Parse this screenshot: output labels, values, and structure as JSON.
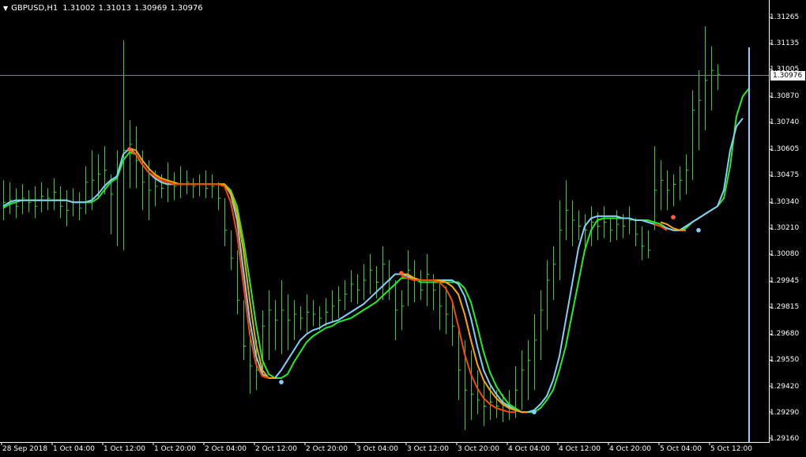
{
  "symbol_bar": {
    "arrow": "▼",
    "symbol": "GBPUSD,H1",
    "open": "1.31002",
    "high": "1.31013",
    "low": "1.30969",
    "close": "1.30976"
  },
  "colors": {
    "background": "#000000",
    "axis": "#ffffff",
    "bars": "#32cd32",
    "bid_line": "#708090",
    "line_green": "#22ee22",
    "line_blue": "#87cefa",
    "line_orange": "#ffa500",
    "line_red": "#ff4500",
    "dot_blue": "#87cefa",
    "dot_orange": "#ff6633"
  },
  "price_axis": {
    "labels": [
      "1.31265",
      "1.31135",
      "1.31005",
      "1.30870",
      "1.30740",
      "1.30605",
      "1.30475",
      "1.30340",
      "1.30210",
      "1.30080",
      "1.29945",
      "1.29815",
      "1.29680",
      "1.29550",
      "1.29420",
      "1.29290",
      "1.29160"
    ],
    "current_price": "1.30976"
  },
  "time_axis": {
    "labels": [
      "28 Sep 2018",
      "1 Oct 04:00",
      "1 Oct 12:00",
      "1 Oct 20:00",
      "2 Oct 04:00",
      "2 Oct 12:00",
      "2 Oct 20:00",
      "3 Oct 04:00",
      "3 Oct 12:00",
      "3 Oct 20:00",
      "4 Oct 04:00",
      "4 Oct 12:00",
      "4 Oct 20:00",
      "5 Oct 04:00",
      "5 Oct 12:00"
    ]
  },
  "chart_data": {
    "type": "line",
    "title": "",
    "x_axis": "time (H1 bars)",
    "y_range": [
      1.2913,
      1.313
    ],
    "vertical_marker_bar": 118,
    "series": [
      {
        "name": "",
        "color": "#22ee22",
        "values": [
          1.3031,
          1.3033,
          1.3034,
          1.3035,
          1.3035,
          1.3035,
          1.3035,
          1.3035,
          1.3035,
          1.3035,
          1.3035,
          1.3034,
          1.3034,
          1.3034,
          1.3034,
          1.3036,
          1.304,
          1.3044,
          1.3046,
          1.3055,
          1.3059,
          1.3058,
          1.3053,
          1.3049,
          1.3046,
          1.3044,
          1.3043,
          1.3043,
          1.3043,
          1.3043,
          1.3043,
          1.3043,
          1.3043,
          1.3043,
          1.3043,
          1.3043,
          1.304,
          1.3032,
          1.3015,
          1.2995,
          1.2973,
          1.2955,
          1.2948,
          1.2946,
          1.2946,
          1.2948,
          1.2954,
          1.2959,
          1.2964,
          1.2967,
          1.2969,
          1.2971,
          1.2972,
          1.2974,
          1.2975,
          1.2976,
          1.2978,
          1.298,
          1.2982,
          1.2984,
          1.2987,
          1.299,
          1.2993,
          1.2996,
          1.2996,
          1.2996,
          1.2994,
          1.2994,
          1.2994,
          1.2994,
          1.2994,
          1.2994,
          1.2994,
          1.2991,
          1.2984,
          1.2972,
          1.2959,
          1.2949,
          1.2942,
          1.2937,
          1.2933,
          1.2931,
          1.2929,
          1.2929,
          1.2929,
          1.2931,
          1.2935,
          1.294,
          1.295,
          1.2962,
          1.2978,
          1.2994,
          1.301,
          1.302,
          1.3025,
          1.3026,
          1.3026,
          1.3026,
          1.3026,
          1.3026,
          1.3025,
          1.3025,
          1.3025,
          1.3024,
          1.3023,
          1.3021,
          1.302,
          1.302,
          1.3021,
          1.3024,
          1.3026,
          1.3028,
          1.303,
          1.3032,
          1.3036,
          1.3052,
          1.3077,
          1.3087,
          1.3091
        ]
      },
      {
        "name": "",
        "color": "#87cefa",
        "values": [
          1.3032,
          1.3034,
          1.3035,
          1.3035,
          1.3035,
          1.3035,
          1.3035,
          1.3035,
          1.3035,
          1.3035,
          1.3035,
          1.3034,
          1.3034,
          1.3034,
          1.3035,
          1.3038,
          1.3042,
          1.3045,
          1.3047,
          1.3058,
          1.3061,
          1.3058,
          1.3053,
          1.3049,
          1.3046,
          1.3044,
          1.3043,
          1.3043,
          1.3043,
          1.3043,
          1.3043,
          1.3043,
          1.3043,
          1.3043,
          1.3043,
          1.3043,
          1.3038,
          1.3025,
          1.3,
          1.2975,
          1.2957,
          1.2948,
          1.2946,
          1.2946,
          1.295,
          1.2955,
          1.296,
          1.2965,
          1.2968,
          1.297,
          1.2971,
          1.2973,
          1.2974,
          1.2975,
          1.2977,
          1.2979,
          1.2981,
          1.2983,
          1.2986,
          1.2989,
          1.2992,
          1.2995,
          1.2998,
          1.2998,
          1.2997,
          1.2996,
          1.2995,
          1.2995,
          1.2995,
          1.2995,
          1.2995,
          1.2995,
          1.2993,
          1.2987,
          1.2976,
          1.2962,
          1.295,
          1.2943,
          1.2938,
          1.2934,
          1.2932,
          1.293,
          1.2929,
          1.2929,
          1.293,
          1.2933,
          1.2937,
          1.2945,
          1.2957,
          1.2975,
          1.2993,
          1.3011,
          1.3022,
          1.3026,
          1.3027,
          1.3027,
          1.3027,
          1.3027,
          1.3026,
          1.3026,
          1.3025,
          1.3025,
          1.3024,
          1.3023,
          1.3022,
          1.3021,
          1.302,
          1.302,
          1.3022,
          1.3024,
          1.3026,
          1.3028,
          1.303,
          1.3032,
          1.304,
          1.306,
          1.3072,
          1.3076
        ]
      },
      {
        "name": "",
        "color": "#ffa500",
        "values": [
          null,
          null,
          null,
          null,
          null,
          null,
          null,
          null,
          null,
          null,
          null,
          null,
          null,
          null,
          null,
          null,
          null,
          null,
          null,
          null,
          1.3061,
          1.306,
          1.3055,
          1.3051,
          1.3048,
          1.3046,
          1.3045,
          1.3044,
          1.3043,
          1.3043,
          1.3043,
          1.3043,
          1.3043,
          1.3043,
          1.3043,
          1.3043,
          1.3039,
          1.3029,
          1.301,
          1.2985,
          1.2963,
          1.295,
          1.2946,
          1.2946,
          null,
          null,
          null,
          null,
          null,
          null,
          null,
          null,
          null,
          null,
          null,
          null,
          null,
          null,
          null,
          null,
          null,
          null,
          null,
          1.2998,
          1.2998,
          1.2996,
          1.2995,
          1.2995,
          1.2995,
          1.2995,
          1.2994,
          1.2992,
          1.2988,
          1.2978,
          1.2965,
          1.2953,
          1.2945,
          1.294,
          1.2936,
          1.2933,
          1.2931,
          1.293,
          1.2929,
          1.2929,
          null,
          null,
          null,
          null,
          null,
          null,
          null,
          null,
          null,
          null,
          null,
          null,
          null,
          null,
          null,
          null,
          null,
          null,
          null,
          null,
          1.3024,
          1.3023,
          1.3021,
          1.302,
          1.302,
          null,
          null,
          null,
          null,
          null,
          null,
          null,
          null,
          null,
          null
        ]
      },
      {
        "name": "",
        "color": "#ff4500",
        "values": [
          null,
          null,
          null,
          null,
          null,
          null,
          null,
          null,
          null,
          null,
          null,
          null,
          null,
          null,
          null,
          null,
          null,
          null,
          null,
          null,
          1.306,
          1.3058,
          1.3053,
          1.3049,
          1.3047,
          1.3045,
          1.3044,
          1.3043,
          1.3043,
          1.3043,
          1.3043,
          1.3043,
          1.3043,
          1.3043,
          1.3043,
          1.3042,
          1.3034,
          1.3018,
          1.2993,
          1.2968,
          1.2953,
          1.2947,
          1.2946,
          null,
          null,
          null,
          null,
          null,
          null,
          null,
          null,
          null,
          null,
          null,
          null,
          null,
          null,
          null,
          null,
          null,
          null,
          null,
          null,
          1.2997,
          1.2996,
          1.2995,
          1.2995,
          1.2995,
          1.2995,
          1.2994,
          1.2991,
          1.2985,
          1.2972,
          1.2958,
          1.2948,
          1.2941,
          1.2936,
          1.2933,
          1.2931,
          1.293,
          1.2929,
          1.2929,
          null,
          null,
          null,
          null,
          null,
          null,
          null,
          null,
          null,
          null,
          null,
          null,
          null,
          null,
          null,
          null,
          null,
          null,
          null,
          null,
          null,
          1.3023,
          1.3022,
          1.302,
          null,
          null,
          null,
          null,
          null,
          null,
          null,
          null,
          null,
          null,
          null
        ]
      }
    ],
    "markers": [
      {
        "bar": 20,
        "value": 1.30605,
        "color": "#ff6633"
      },
      {
        "bar": 44,
        "value": 1.2944,
        "color": "#87cefa"
      },
      {
        "bar": 63,
        "value": 1.29985,
        "color": "#ff6633"
      },
      {
        "bar": 84,
        "value": 1.2929,
        "color": "#87cefa"
      },
      {
        "bar": 106,
        "value": 1.30265,
        "color": "#ff6633"
      },
      {
        "bar": 110,
        "value": 1.302,
        "color": "#87cefa"
      }
    ],
    "bars_hlc": [
      [
        1.3045,
        1.3025,
        1.3034
      ],
      [
        1.3044,
        1.3028,
        1.3035
      ],
      [
        1.3041,
        1.3026,
        1.3032
      ],
      [
        1.3043,
        1.3028,
        1.3036
      ],
      [
        1.304,
        1.3029,
        1.3034
      ],
      [
        1.3042,
        1.3026,
        1.3032
      ],
      [
        1.3044,
        1.3029,
        1.3037
      ],
      [
        1.3041,
        1.303,
        1.3036
      ],
      [
        1.3046,
        1.303,
        1.3039
      ],
      [
        1.3042,
        1.3026,
        1.3032
      ],
      [
        1.304,
        1.3022,
        1.303
      ],
      [
        1.3041,
        1.3027,
        1.3034
      ],
      [
        1.3039,
        1.3025,
        1.3031
      ],
      [
        1.3052,
        1.3028,
        1.3044
      ],
      [
        1.306,
        1.303,
        1.3045
      ],
      [
        1.3058,
        1.3036,
        1.3048
      ],
      [
        1.3062,
        1.3038,
        1.305
      ],
      [
        1.3048,
        1.3018,
        1.3038
      ],
      [
        1.306,
        1.3012,
        1.305
      ],
      [
        1.3115,
        1.301,
        1.306
      ],
      [
        1.3075,
        1.3041,
        1.3063
      ],
      [
        1.3072,
        1.3041,
        1.3055
      ],
      [
        1.306,
        1.303,
        1.3044
      ],
      [
        1.3055,
        1.3025,
        1.304
      ],
      [
        1.305,
        1.3032,
        1.3042
      ],
      [
        1.3048,
        1.3036,
        1.3041
      ],
      [
        1.3054,
        1.3034,
        1.3043
      ],
      [
        1.3049,
        1.3035,
        1.3042
      ],
      [
        1.3052,
        1.3036,
        1.3043
      ],
      [
        1.305,
        1.3038,
        1.3044
      ],
      [
        1.3046,
        1.3036,
        1.3042
      ],
      [
        1.3048,
        1.3037,
        1.3043
      ],
      [
        1.305,
        1.3036,
        1.3041
      ],
      [
        1.3048,
        1.3036,
        1.3042
      ],
      [
        1.3044,
        1.303,
        1.3036
      ],
      [
        1.3036,
        1.3012,
        1.302
      ],
      [
        1.302,
        1.3,
        1.3006
      ],
      [
        1.301,
        1.2978,
        1.2985
      ],
      [
        1.2985,
        1.2955,
        1.2962
      ],
      [
        1.297,
        1.2938,
        1.2952
      ],
      [
        1.2965,
        1.294,
        1.295
      ],
      [
        1.298,
        1.2948,
        1.2972
      ],
      [
        1.299,
        1.2955,
        1.298
      ],
      [
        1.2985,
        1.296,
        1.2975
      ],
      [
        1.2995,
        1.2958,
        1.298
      ],
      [
        1.2988,
        1.296,
        1.2975
      ],
      [
        1.2985,
        1.2965,
        1.2978
      ],
      [
        1.2982,
        1.297,
        1.2976
      ],
      [
        1.2988,
        1.2968,
        1.2979
      ],
      [
        1.2985,
        1.2972,
        1.2978
      ],
      [
        1.2982,
        1.297,
        1.2976
      ],
      [
        1.2986,
        1.2972,
        1.2979
      ],
      [
        1.299,
        1.2974,
        1.2982
      ],
      [
        1.2992,
        1.2976,
        1.2985
      ],
      [
        1.2995,
        1.298,
        1.2988
      ],
      [
        1.3,
        1.2984,
        1.2993
      ],
      [
        1.2998,
        1.2983,
        1.299
      ],
      [
        1.3003,
        1.2985,
        1.2995
      ],
      [
        1.3008,
        1.2988,
        1.3
      ],
      [
        1.3002,
        1.2986,
        1.2994
      ],
      [
        1.3012,
        1.2985,
        1.3003
      ],
      [
        1.3005,
        1.2985,
        1.2995
      ],
      [
        1.2995,
        1.2965,
        1.298
      ],
      [
        1.299,
        1.297,
        1.2982
      ],
      [
        1.301,
        1.2982,
        1.3
      ],
      [
        1.3005,
        1.2984,
        1.2996
      ],
      [
        1.3,
        1.2985,
        1.299
      ],
      [
        1.3008,
        1.2982,
        1.2998
      ],
      [
        1.2998,
        1.298,
        1.299
      ],
      [
        1.2995,
        1.297,
        1.2982
      ],
      [
        1.2992,
        1.2968,
        1.2978
      ],
      [
        1.2985,
        1.2962,
        1.2972
      ],
      [
        1.297,
        1.2935,
        1.295
      ],
      [
        1.2965,
        1.292,
        1.294
      ],
      [
        1.296,
        1.2925,
        1.2938
      ],
      [
        1.295,
        1.2928,
        1.2935
      ],
      [
        1.2945,
        1.2922,
        1.2932
      ],
      [
        1.2942,
        1.2925,
        1.2934
      ],
      [
        1.294,
        1.2926,
        1.2932
      ],
      [
        1.2938,
        1.2924,
        1.293
      ],
      [
        1.294,
        1.2925,
        1.2931
      ],
      [
        1.2952,
        1.2926,
        1.294
      ],
      [
        1.296,
        1.293,
        1.295
      ],
      [
        1.2965,
        1.2935,
        1.2955
      ],
      [
        1.2978,
        1.294,
        1.2965
      ],
      [
        1.299,
        1.2955,
        1.298
      ],
      [
        1.3005,
        1.297,
        1.2995
      ],
      [
        1.3012,
        1.2985,
        1.3003
      ],
      [
        1.3035,
        1.2995,
        1.302
      ],
      [
        1.3045,
        1.3015,
        1.303
      ],
      [
        1.3035,
        1.3012,
        1.3025
      ],
      [
        1.303,
        1.3015,
        1.3022
      ],
      [
        1.3028,
        1.301,
        1.302
      ],
      [
        1.3032,
        1.3012,
        1.3024
      ],
      [
        1.3029,
        1.3015,
        1.3022
      ],
      [
        1.3032,
        1.3016,
        1.3024
      ],
      [
        1.3026,
        1.3014,
        1.302
      ],
      [
        1.303,
        1.3015,
        1.3023
      ],
      [
        1.3028,
        1.3016,
        1.3022
      ],
      [
        1.3032,
        1.3018,
        1.3025
      ],
      [
        1.3026,
        1.3012,
        1.3018
      ],
      [
        1.3022,
        1.3005,
        1.3012
      ],
      [
        1.302,
        1.3006,
        1.301
      ],
      [
        1.3062,
        1.302,
        1.304
      ],
      [
        1.3055,
        1.303,
        1.3045
      ],
      [
        1.305,
        1.303,
        1.304
      ],
      [
        1.3048,
        1.3032,
        1.3043
      ],
      [
        1.3052,
        1.3035,
        1.3045
      ],
      [
        1.3058,
        1.3038,
        1.305
      ],
      [
        1.309,
        1.3045,
        1.308
      ],
      [
        1.31,
        1.306,
        1.3085
      ],
      [
        1.3122,
        1.307,
        1.3095
      ],
      [
        1.3112,
        1.308,
        1.31
      ],
      [
        1.3103,
        1.309,
        1.3098
      ]
    ]
  }
}
